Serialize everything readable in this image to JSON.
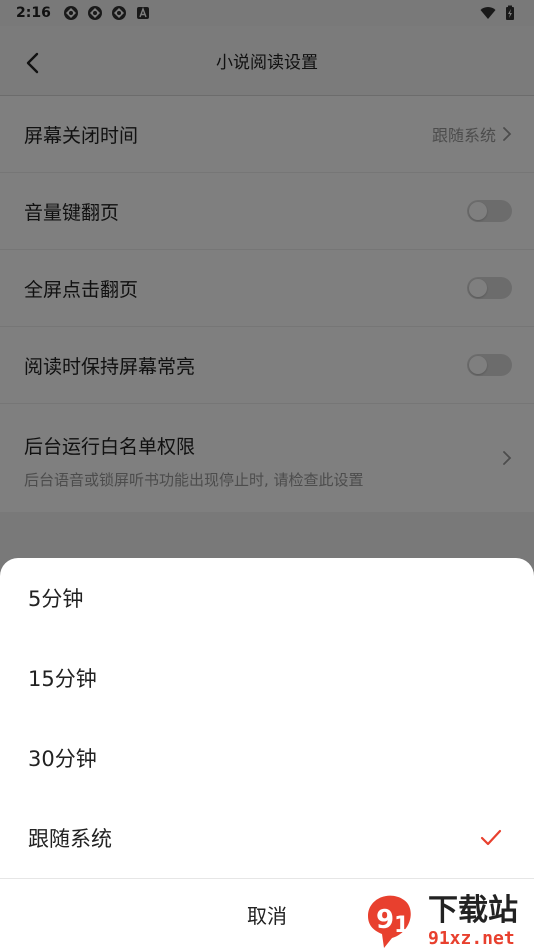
{
  "status_bar": {
    "time": "2:16"
  },
  "header": {
    "title": "小说阅读设置"
  },
  "settings": {
    "screen_off": {
      "label": "屏幕关闭时间",
      "value": "跟随系统"
    },
    "volume_key": {
      "label": "音量键翻页",
      "enabled": false
    },
    "fullscreen_tap": {
      "label": "全屏点击翻页",
      "enabled": false
    },
    "keep_screen_on": {
      "label": "阅读时保持屏幕常亮",
      "enabled": false
    },
    "background_whitelist": {
      "label": "后台运行白名单权限",
      "description": "后台语音或锁屏听书功能出现停止时, 请检查此设置"
    }
  },
  "sheet": {
    "options": [
      {
        "label": "5分钟",
        "selected": false
      },
      {
        "label": "15分钟",
        "selected": false
      },
      {
        "label": "30分钟",
        "selected": false
      },
      {
        "label": "跟随系统",
        "selected": true
      }
    ],
    "cancel_label": "取消"
  },
  "colors": {
    "accent": "#e8402e",
    "toggle_off": "#d9d9d9",
    "overlay": "#000000"
  },
  "watermark": {
    "brand": "下载站",
    "site": "91xz.net"
  }
}
